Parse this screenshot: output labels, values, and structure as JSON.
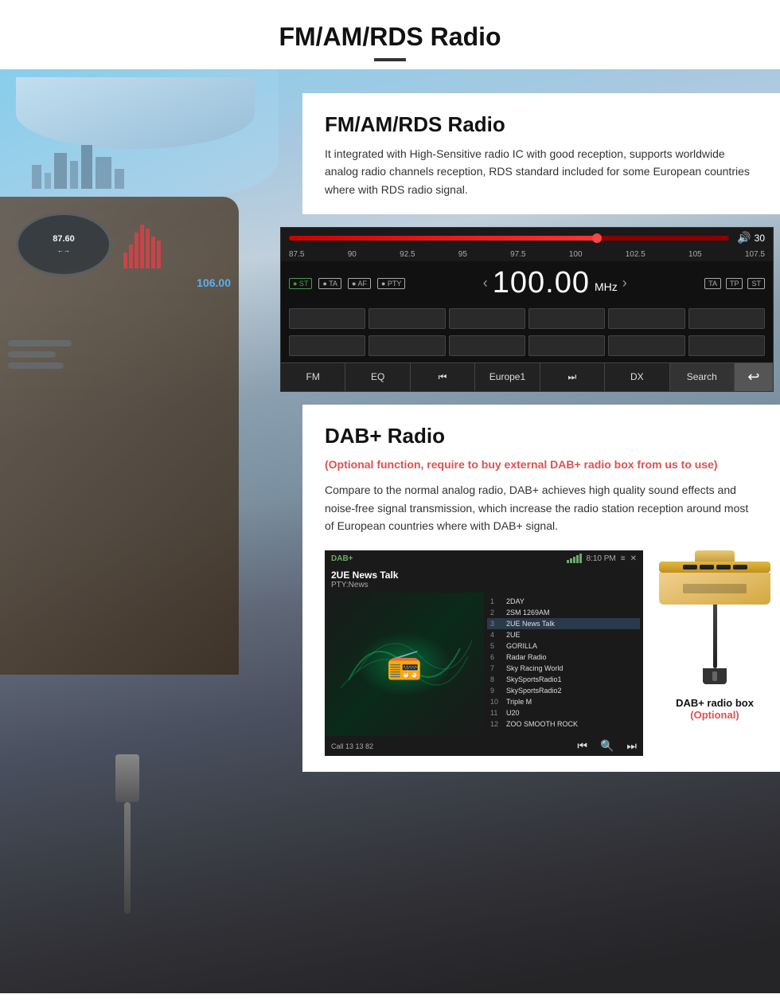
{
  "page": {
    "title": "FM/AM/RDS Radio",
    "title_divider": true
  },
  "fm_section": {
    "title": "FM/AM/RDS Radio",
    "description": "It integrated with High-Sensitive radio IC with good reception, supports worldwide analog radio channels reception, RDS standard included for some European countries where with RDS radio signal."
  },
  "radio_ui": {
    "volume_label": "30",
    "frequency": "100.00",
    "frequency_unit": "MHz",
    "freq_scale": [
      "87.5",
      "90",
      "92.5",
      "95",
      "97.5",
      "100",
      "102.5",
      "105",
      "107.5"
    ],
    "badges": [
      "ST",
      "TA",
      "AF",
      "PTY"
    ],
    "right_badges": [
      "TA",
      "TP",
      "ST"
    ],
    "buttons": [
      "FM",
      "EQ",
      "⏮",
      "Europe1",
      "⏭",
      "DX",
      "Search"
    ]
  },
  "dab_section": {
    "title": "DAB+ Radio",
    "optional_text": "(Optional function, require to buy external DAB+ radio box from us to use)",
    "description": "Compare to the normal analog radio, DAB+ achieves high quality sound effects and noise-free signal transmission, which increase the radio station reception around most of European countries where with DAB+ signal."
  },
  "dab_screen": {
    "label": "DAB+",
    "time": "8:10 PM",
    "station": "2UE News Talk",
    "pty": "PTY:News",
    "channels": [
      {
        "num": "1",
        "name": "2DAY"
      },
      {
        "num": "2",
        "name": "2SM 1269AM"
      },
      {
        "num": "3",
        "name": "2UE News Talk"
      },
      {
        "num": "4",
        "name": "2UE"
      },
      {
        "num": "5",
        "name": "GORILLA"
      },
      {
        "num": "6",
        "name": "Radar Radio"
      },
      {
        "num": "7",
        "name": "Sky Racing World"
      },
      {
        "num": "8",
        "name": "SkySportsRadio1"
      },
      {
        "num": "9",
        "name": "SkySportsRadio2"
      },
      {
        "num": "10",
        "name": "Triple M"
      },
      {
        "num": "11",
        "name": "U20"
      },
      {
        "num": "12",
        "name": "ZOO SMOOTH ROCK"
      }
    ],
    "call_info": "Call 13 13 82",
    "controls": [
      "⏮",
      "🔍",
      "⏭"
    ]
  },
  "dab_box": {
    "label": "DAB+ radio box",
    "sublabel": "(Optional)"
  }
}
